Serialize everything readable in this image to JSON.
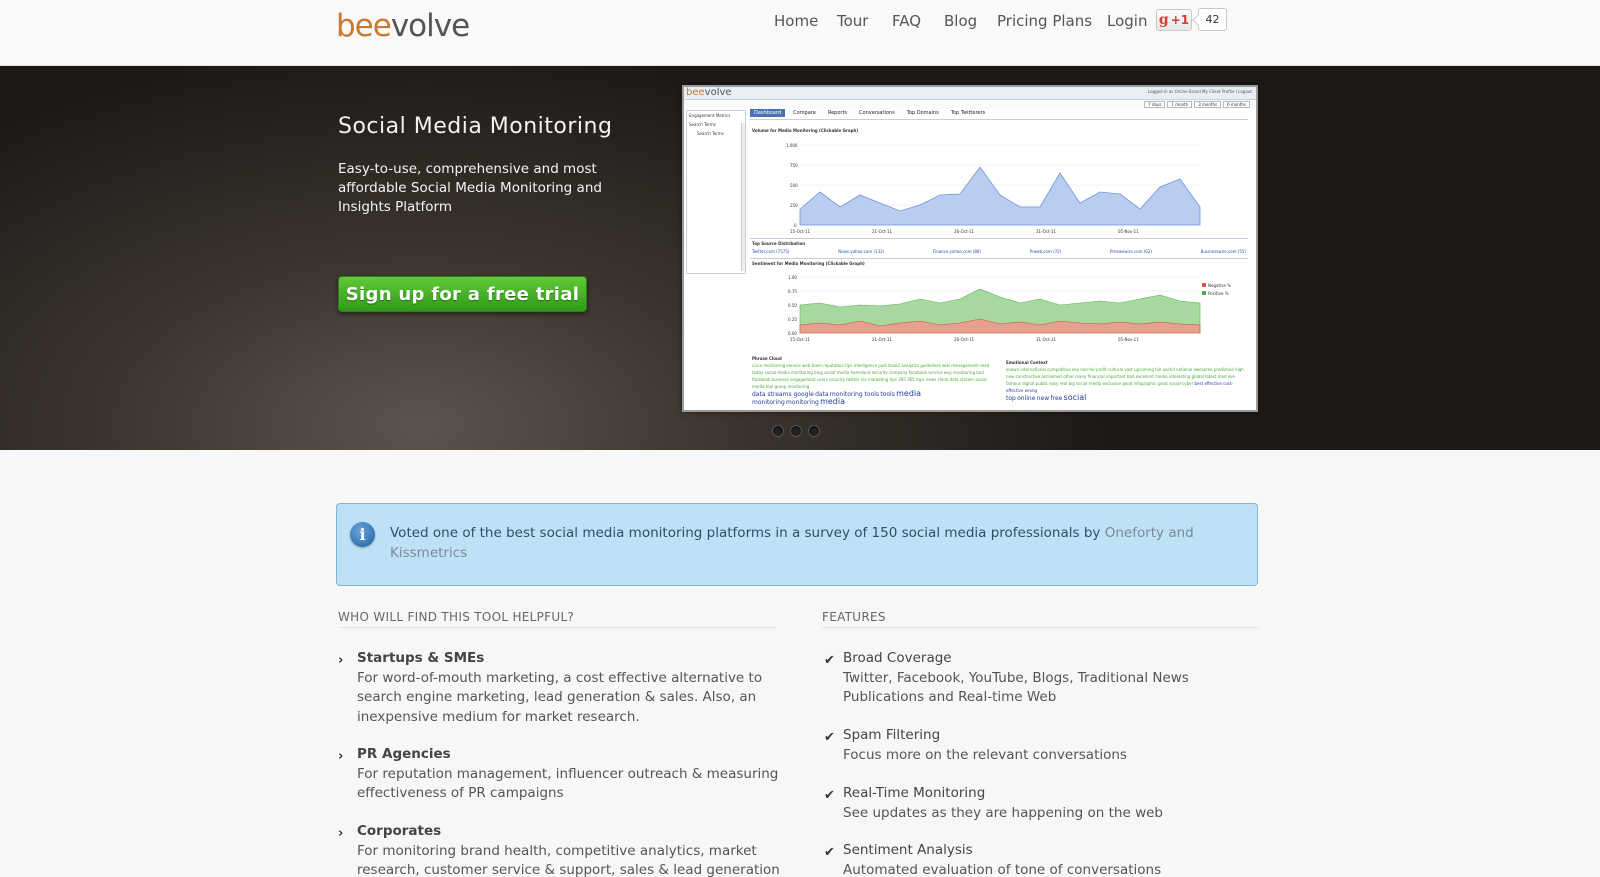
{
  "header": {
    "logo_part1": "bee",
    "logo_part2": "volve",
    "nav": [
      {
        "label": "Home"
      },
      {
        "label": "Tour"
      },
      {
        "label": "FAQ"
      },
      {
        "label": "Blog"
      },
      {
        "label": "Pricing Plans"
      },
      {
        "label": "Login"
      }
    ],
    "gplus_label": "+1",
    "gplus_count": "42"
  },
  "hero": {
    "title": "Social Media Monitoring",
    "subtitle": "Easy-to-use, comprehensive and most affordable Social Media Monitoring and Insights Platform",
    "cta_label": "Sign up for a free trial",
    "slides": 3
  },
  "app_preview": {
    "logo_part1": "bee",
    "logo_part2": "volve",
    "login_text": "Logged in as Online Brand My Client Profile | Logout",
    "periods": [
      "7 days",
      "1 month",
      "3 months",
      "6 months"
    ],
    "sidebar_lines": [
      "Engagement Metrics",
      "Search Terms",
      "Search Terms"
    ],
    "tabs": [
      {
        "label": "Dashboard",
        "active": true
      },
      {
        "label": "Compare",
        "active": false
      },
      {
        "label": "Reports",
        "active": false
      },
      {
        "label": "Conversations",
        "active": false
      },
      {
        "label": "Top Domains",
        "active": false
      },
      {
        "label": "Top Twitterers",
        "active": false
      }
    ],
    "volume_title": "Volume for Media Monitoring (Clickable Graph)",
    "volume_yticks": [
      "1,000",
      "750",
      "500",
      "250",
      "0"
    ],
    "volume_xticks": [
      "15-Oct-11",
      "21-Oct-11",
      "26-Oct-11",
      "31-Oct-11",
      "05-Nov-11"
    ],
    "source_title": "Top Source Distribution",
    "source_links": [
      "Twitter.com (7575)",
      "News.yahoo.com (132)",
      "Finance.yahoo.com (88)",
      "Prweb.com (72)",
      "Prnewswire.com (62)",
      "Businesswire.com (55)"
    ],
    "sentiment_title": "Sentiment for Media Monitoring (Clickable Graph)",
    "sentiment_yticks": [
      "1.00",
      "0.75",
      "0.50",
      "0.25",
      "0.00"
    ],
    "sentiment_xticks": [
      "15-Oct-11",
      "21-Oct-11",
      "26-Oct-11",
      "31-Oct-11",
      "05-Nov-11"
    ],
    "sentiment_legend": [
      "Negative %",
      "Positive %"
    ],
    "phrase_cloud_title": "Phrase Cloud",
    "emotional_title": "Emotional Context",
    "phrase_small": "cisco  monitoring service  web  team  reputation  tips  intelligence  post  brand  analytics  guidelines  wiki  management  need  today  social media monitoring  blog  social media  homeland security  company  facebook  service  way  monitoring tool  facebook  business  engagement  users  security  twitter  via  marketing  tips 365  365  tops  news  china  data stream  social media  tool  group  monitoring",
    "phrase_mid": "data  streams  google",
    "phrase_big": [
      "data",
      "monitoring tools",
      "tools",
      "media",
      "monitoring",
      "monitoring",
      "media"
    ],
    "emotional_small": "known  international  competitive  key  non-for-profit  cultural  vast  upcoming  full  useful  national  awesome  predictive  high  new  constructive  acclaimed  other  many  financial  important  bad  excellent  media  interesting  global  latest  mad  live  famous  digital  public  easy  real  big  social media  exclusive  good  infographic  great  social-cyber",
    "emotional_big": [
      "best",
      "effective",
      "cost-effective",
      "wrong",
      "top",
      "online",
      "new",
      "free",
      "social"
    ]
  },
  "notice": {
    "text": "Voted one of the best social media monitoring platforms in a survey of 150 social media professionals by ",
    "link": "Oneforty and Kissmetrics"
  },
  "left_column": {
    "title": "WHO WILL FIND THIS TOOL HELPFUL?",
    "items": [
      {
        "head": "Startups & SMEs",
        "body": "For word-of-mouth marketing, a cost effective alternative to search engine marketing, lead generation & sales. Also, an inexpensive medium for market research."
      },
      {
        "head": "PR Agencies",
        "body": "For reputation management, influencer outreach & measuring effectiveness of PR campaigns"
      },
      {
        "head": "Corporates",
        "body": "For monitoring brand health, competitive analytics, market research, customer service & support, sales & lead generation"
      }
    ]
  },
  "right_column": {
    "title": "FEATURES",
    "items": [
      {
        "head": "Broad Coverage",
        "body": "Twitter, Facebook, YouTube, Blogs, Traditional News Publications and Real-time Web"
      },
      {
        "head": "Spam Filtering",
        "body": "Focus more on the relevant conversations"
      },
      {
        "head": "Real-Time Monitoring",
        "body": "See updates as they are happening on the web"
      },
      {
        "head": "Sentiment Analysis",
        "body": "Automated evaluation of tone of conversations"
      }
    ]
  },
  "colors": {
    "brand_orange": "#c97a2e",
    "cta_green": "#3fae22",
    "notice_bg": "#bfe1f6",
    "chart_blue": "#b8cdef",
    "chart_green": "#a7d8a0",
    "chart_red": "#e7a08e"
  },
  "icons": {
    "info": "info-circle-icon",
    "bullet_left": "chevron-right-icon",
    "bullet_right": "check-icon"
  }
}
